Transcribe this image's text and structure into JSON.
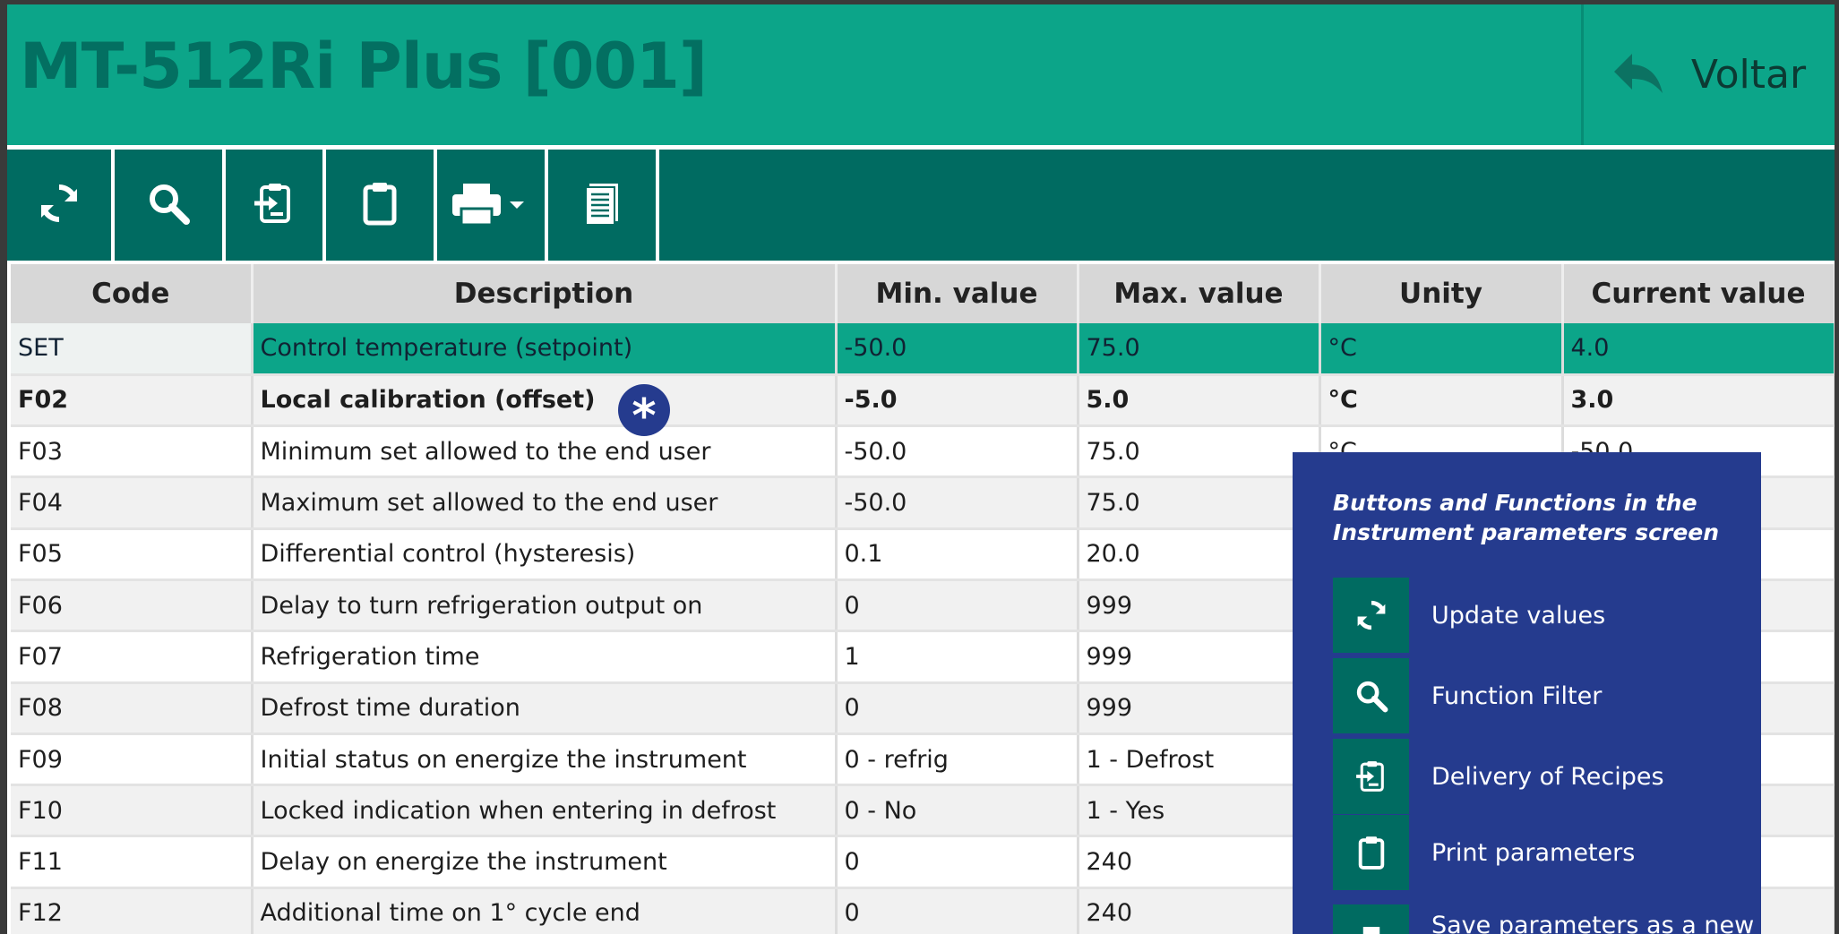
{
  "header": {
    "title": "MT-512Ri Plus [001]",
    "back_label": "Voltar",
    "back_icon": "reply-arrow-icon"
  },
  "toolbar": {
    "buttons": [
      {
        "name": "refresh-icon"
      },
      {
        "name": "search-icon"
      },
      {
        "name": "recipe-delivery-icon"
      },
      {
        "name": "clipboard-icon"
      },
      {
        "name": "printer-dropdown-icon"
      },
      {
        "name": "document-list-icon"
      }
    ]
  },
  "table": {
    "columns": [
      "Code",
      "Description",
      "Min. value",
      "Max. value",
      "Unity",
      "Current value"
    ],
    "rows": [
      {
        "code": "SET",
        "description": "Control temperature (setpoint)",
        "min": "-50.0",
        "max": "75.0",
        "unity": "°C",
        "current": "4.0"
      },
      {
        "code": "F02",
        "description": "Local calibration (offset)",
        "min": "-5.0",
        "max": "5.0",
        "unity": "°C",
        "current": "3.0"
      },
      {
        "code": "F03",
        "description": "Minimum set allowed to the end user",
        "min": "-50.0",
        "max": "75.0",
        "unity": "°C",
        "current": "-50.0"
      },
      {
        "code": "F04",
        "description": "Maximum set allowed to the end user",
        "min": "-50.0",
        "max": "75.0",
        "unity": "",
        "current": ""
      },
      {
        "code": "F05",
        "description": "Differential control (hysteresis)",
        "min": "0.1",
        "max": "20.0",
        "unity": "",
        "current": ""
      },
      {
        "code": "F06",
        "description": "Delay to turn refrigeration output on",
        "min": "0",
        "max": "999",
        "unity": "",
        "current": ""
      },
      {
        "code": "F07",
        "description": "Refrigeration time",
        "min": "1",
        "max": "999",
        "unity": "",
        "current": ""
      },
      {
        "code": "F08",
        "description": "Defrost time duration",
        "min": "0",
        "max": "999",
        "unity": "",
        "current": ""
      },
      {
        "code": "F09",
        "description": "Initial status on energize the instrument",
        "min": "0 - refrig",
        "max": "1 - Defrost",
        "unity": "",
        "current": ""
      },
      {
        "code": "F10",
        "description": "Locked indication when entering in defrost",
        "min": "0 - No",
        "max": "1 - Yes",
        "unity": "",
        "current": ""
      },
      {
        "code": "F11",
        "description": "Delay on energize the instrument",
        "min": "0",
        "max": "240",
        "unity": "",
        "current": ""
      },
      {
        "code": "F12",
        "description": "Additional time on 1° cycle end",
        "min": "0",
        "max": "240",
        "unity": "",
        "current": ""
      }
    ]
  },
  "marker": {
    "symbol": "*"
  },
  "help": {
    "title": "Buttons and Functions in the Instrument parameters screen",
    "items": [
      {
        "icon": "refresh-icon",
        "label": "Update values"
      },
      {
        "icon": "search-icon",
        "label": "Function Filter"
      },
      {
        "icon": "recipe-delivery-icon",
        "label": "Delivery of Recipes"
      },
      {
        "icon": "clipboard-icon",
        "label": "Print parameters"
      },
      {
        "icon": "printer-icon",
        "label": "Save parameters as a new"
      }
    ]
  },
  "colors": {
    "header": "#0ca589",
    "title": "#036f61",
    "toolbar": "#006b61",
    "help_panel": "#253b8e",
    "selected_row": "#0ca589"
  }
}
